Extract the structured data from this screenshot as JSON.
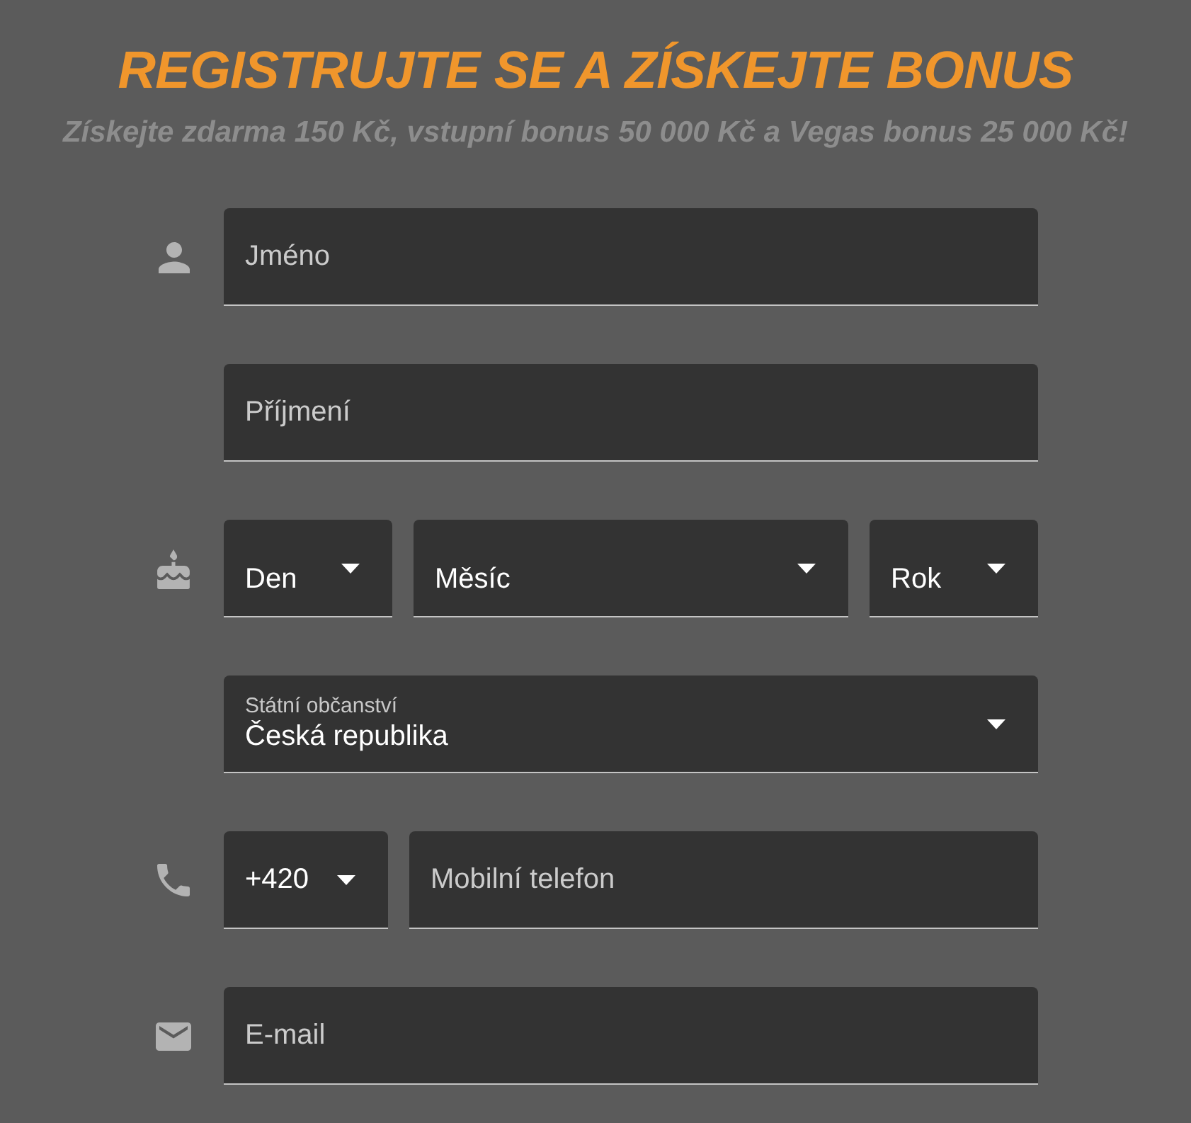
{
  "title": "REGISTRUJTE SE A ZÍSKEJTE BONUS",
  "subtitle": "Získejte zdarma 150 Kč, vstupní bonus 50 000 Kč a Vegas bonus 25 000 Kč!",
  "rows": [
    {
      "fields": [
        {
          "kind": "text",
          "placeholder": "Jméno"
        }
      ]
    },
    {
      "fields": [
        {
          "kind": "text",
          "placeholder": "Příjmení"
        }
      ]
    },
    {
      "fields": [
        {
          "kind": "select",
          "label": "Den"
        },
        {
          "kind": "select",
          "label": "Měsíc"
        },
        {
          "kind": "select",
          "label": "Rok"
        }
      ]
    },
    {
      "fields": [
        {
          "kind": "select",
          "label": "Státní občanství",
          "value": "Česká republika"
        }
      ]
    },
    {
      "fields": [
        {
          "kind": "select",
          "value": "+420"
        },
        {
          "kind": "text",
          "placeholder": "Mobilní telefon"
        }
      ]
    },
    {
      "fields": [
        {
          "kind": "text",
          "placeholder": "E-mail"
        }
      ]
    }
  ]
}
